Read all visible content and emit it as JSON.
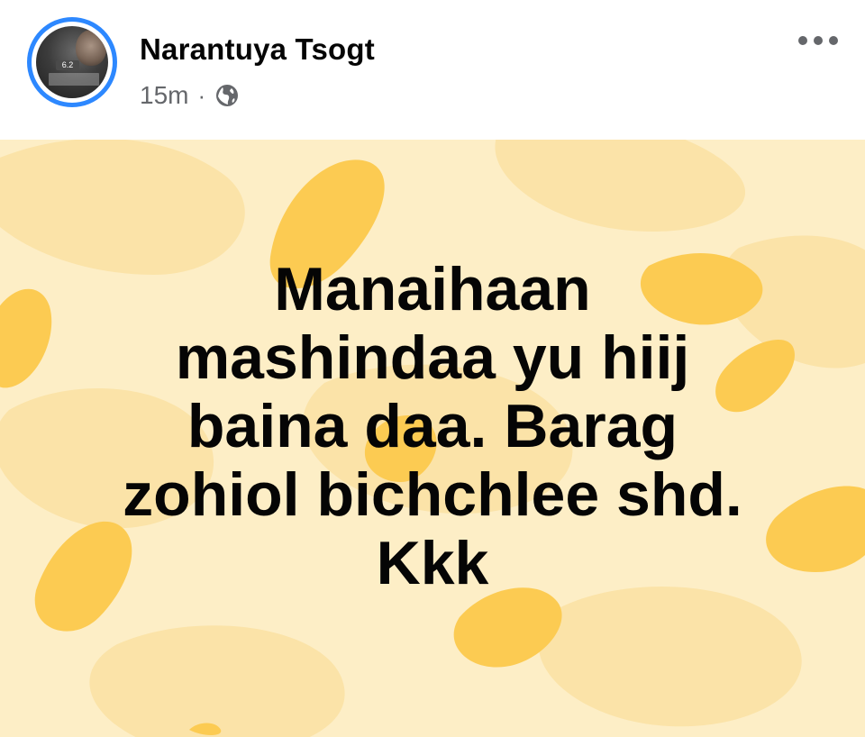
{
  "post": {
    "author_name": "Narantuya Tsogt",
    "timestamp": "15m",
    "separator": "·",
    "privacy_icon": "globe-icon",
    "more_icon": "more-horizontal-icon",
    "avatar_badge": "6.2",
    "text": "Manaihaan\nmashindaa yu hiij\nbaina daa. Barag\nzohiol bichchlee shd.\nKkk"
  },
  "colors": {
    "story_ring": "#2d88ff",
    "background_base": "#fdeec6",
    "background_blob": "#fbe3a8",
    "accent_blob": "#fccb52",
    "text": "#050505",
    "meta_text": "#65676b"
  }
}
